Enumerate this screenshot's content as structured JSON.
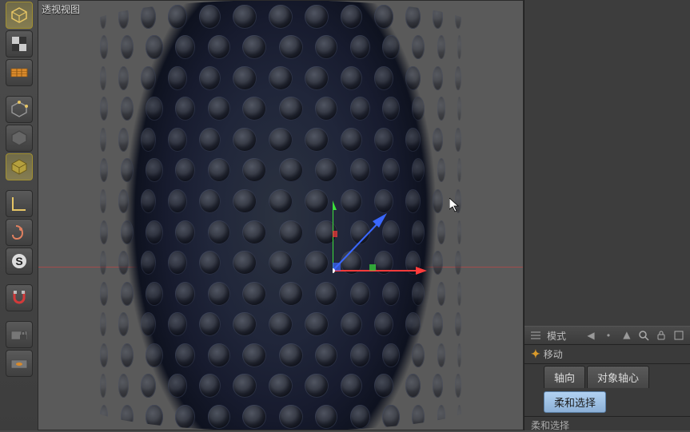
{
  "viewport": {
    "label": "透视视图"
  },
  "toolbar": {
    "items": [
      {
        "name": "cube-outline-icon",
        "active": true
      },
      {
        "name": "checker-icon",
        "active": false
      },
      {
        "name": "grid-icon",
        "active": false
      },
      {
        "name": "cube-point-icon",
        "active": false
      },
      {
        "name": "cube-edge-icon",
        "active": false
      },
      {
        "name": "cube-face-icon",
        "active": true
      },
      {
        "name": "axis-icon",
        "active": false
      },
      {
        "name": "mouse-icon",
        "active": false
      },
      {
        "name": "s-letter-icon",
        "active": false
      },
      {
        "name": "magnet-icon",
        "active": false
      },
      {
        "name": "workplane-lock-icon",
        "active": false
      },
      {
        "name": "workplane-icon",
        "active": false
      }
    ]
  },
  "attributes": {
    "header_mode": "模式",
    "title": "移动",
    "tabs": [
      {
        "label": "轴向",
        "selected": false
      },
      {
        "label": "对象轴心",
        "selected": false
      }
    ],
    "section": "柔和选择",
    "footer": "柔和选择"
  },
  "gizmo": {
    "axes": [
      "x",
      "y",
      "z"
    ]
  }
}
